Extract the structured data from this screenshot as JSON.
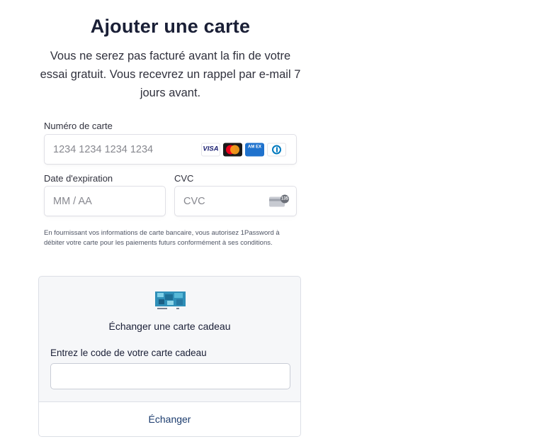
{
  "page": {
    "title": "Ajouter une carte",
    "subtitle": "Vous ne serez pas facturé avant la fin de votre essai gratuit. Vous recevrez un rappel par e-mail 7 jours avant."
  },
  "card_form": {
    "number_label": "Numéro de carte",
    "number_placeholder": "1234 1234 1234 1234",
    "expiry_label": "Date d'expiration",
    "expiry_placeholder": "MM / AA",
    "cvc_label": "CVC",
    "cvc_placeholder": "CVC",
    "brands": [
      "visa",
      "mastercard",
      "amex",
      "diners"
    ],
    "visa_text": "VISA",
    "amex_text": "AM EX",
    "legal": "En fournissant vos informations de carte bancaire, vous autorisez 1Password à débiter votre carte pour les paiements futurs conformément à ses conditions."
  },
  "gift_card": {
    "title": "Échanger une carte cadeau",
    "code_label": "Entrez le code de votre carte cadeau",
    "code_value": "",
    "redeem_label": "Échanger"
  },
  "colors": {
    "text": "#1a1f36",
    "placeholder": "#87888f",
    "link": "#1c3c6e",
    "panel_bg": "#f6f7f9"
  }
}
